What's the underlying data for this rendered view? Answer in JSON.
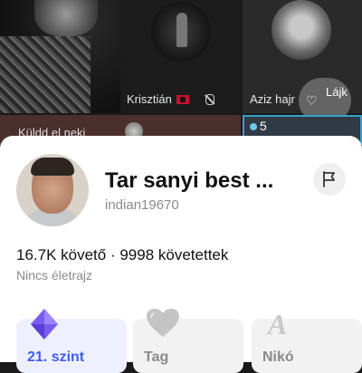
{
  "background": {
    "tiles": [
      {
        "name": ""
      },
      {
        "name": "Krisztián"
      },
      {
        "name": "Aziz hajr",
        "like_label": "Lájk"
      },
      {
        "name": "Küldd el neki"
      },
      {
        "count": "5"
      }
    ]
  },
  "profile": {
    "display_name": "Tar sanyi best ...",
    "username": "indian19670",
    "stats": "16.7K követő · 9998 követettek",
    "bio": "Nincs életrajz",
    "badges": [
      {
        "label": "21. szint",
        "icon": "diamond-icon"
      },
      {
        "label": "Tag",
        "icon": "heart-icon"
      },
      {
        "label": "Nikó",
        "icon": "letter-a-icon"
      }
    ]
  },
  "colors": {
    "accent": "#3e5ef0",
    "sheet": "#ffffff",
    "muted_text": "#8a8a8a"
  }
}
